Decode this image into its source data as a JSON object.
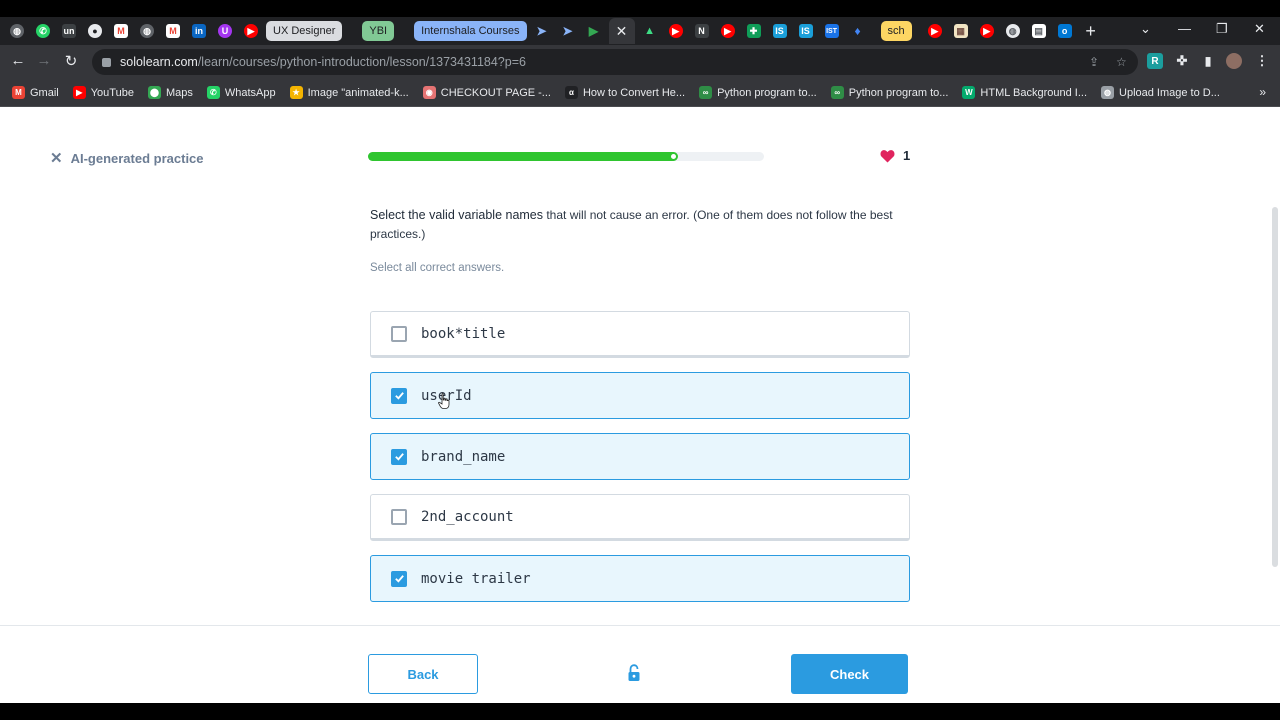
{
  "browser": {
    "tab_pills": [
      {
        "label": "UX Designer",
        "bg": "#dadce0",
        "fg": "#202124"
      },
      {
        "label": "YBI",
        "bg": "#81c995",
        "fg": "#202124"
      },
      {
        "label": "Internshala Courses",
        "bg": "#8ab4f8",
        "fg": "#202124"
      },
      {
        "label": "sch",
        "bg": "#fdd663",
        "fg": "#202124"
      }
    ],
    "url_host": "sololearn.com",
    "url_path": "/learn/courses/python-introduction/lesson/1373431184?p=6",
    "bookmarks": [
      {
        "label": "Gmail",
        "icon": "gmail-icon",
        "color": "#ea4335"
      },
      {
        "label": "YouTube",
        "icon": "youtube-icon",
        "color": "#ff0000"
      },
      {
        "label": "Maps",
        "icon": "maps-icon",
        "color": "#34a853"
      },
      {
        "label": "WhatsApp",
        "icon": "whatsapp-icon",
        "color": "#25d366"
      },
      {
        "label": "Image \"animated-k...",
        "icon": "star-icon",
        "color": "#f4b400"
      },
      {
        "label": "CHECKOUT PAGE -...",
        "icon": "lips-icon",
        "color": "#e57373"
      },
      {
        "label": "How to Convert He...",
        "icon": "alpha-icon",
        "color": "#202124"
      },
      {
        "label": "Python program to...",
        "icon": "gfg-icon",
        "color": "#2f8d46"
      },
      {
        "label": "Python program to...",
        "icon": "gfg-icon",
        "color": "#2f8d46"
      },
      {
        "label": "HTML Background I...",
        "icon": "w3-icon",
        "color": "#04aa6d"
      },
      {
        "label": "Upload Image to D...",
        "icon": "globe-icon",
        "color": "#9aa0a6"
      }
    ]
  },
  "lesson": {
    "close_label": "AI-generated practice",
    "progress": 0.78,
    "lives": "1",
    "question_bold": "Select the valid variable names",
    "question_rest": " that will not cause an error. (One of them does not follow the best practices.)",
    "hint": "Select all correct answers.",
    "options": [
      {
        "label": "book*title",
        "checked": false
      },
      {
        "label": "userId",
        "checked": true
      },
      {
        "label": "brand_name",
        "checked": true
      },
      {
        "label": "2nd_account",
        "checked": false
      },
      {
        "label": "movie trailer",
        "checked": true
      }
    ],
    "back_label": "Back",
    "check_label": "Check"
  },
  "colors": {
    "accent": "#2b9be0",
    "progress": "#2fc52f",
    "heart": "#e0245e"
  }
}
